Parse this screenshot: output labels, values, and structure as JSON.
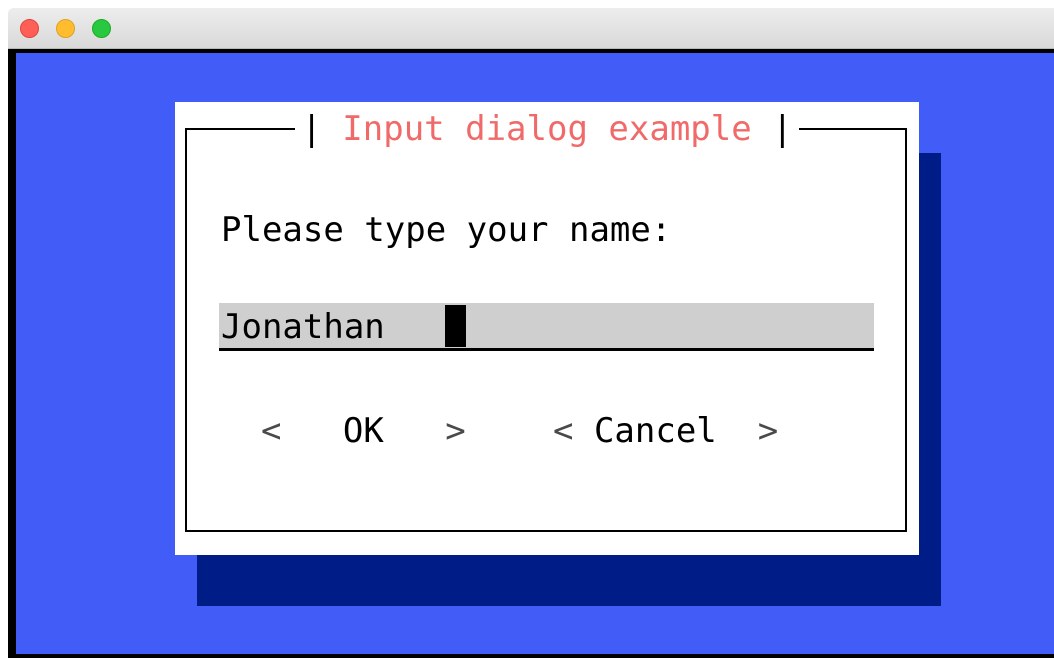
{
  "window": {
    "controls": [
      "close",
      "minimize",
      "zoom"
    ]
  },
  "dialog": {
    "title_left": "| ",
    "title": "Input dialog example",
    "title_right": " |",
    "prompt": "Please type your name:",
    "input_value": "Jonathan",
    "buttons": [
      {
        "open": "<   ",
        "label": "OK",
        "close": "   >"
      },
      {
        "open": "< ",
        "label": "Cancel",
        "close": "  >"
      }
    ]
  },
  "colors": {
    "terminal_background": "#425cf8",
    "shadow": "#001c87",
    "dialog_background": "#ffffff",
    "title_text": "#f06a6a",
    "input_background": "#cfcfcf"
  }
}
